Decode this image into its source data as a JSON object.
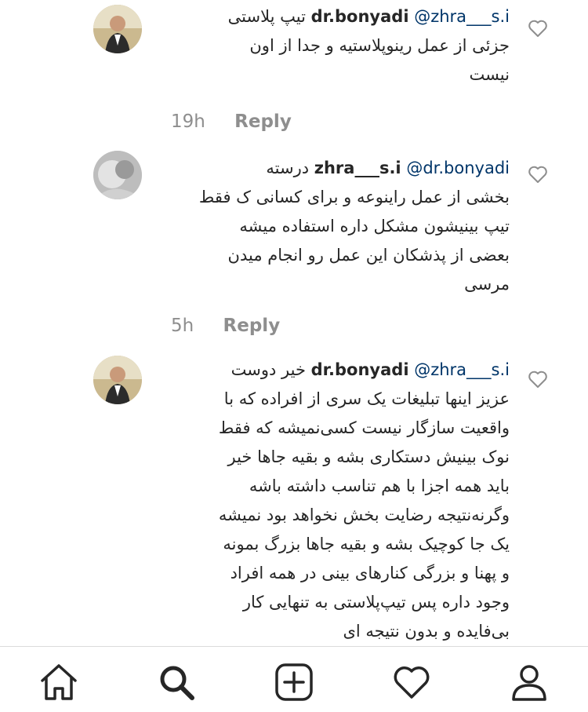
{
  "comments": [
    {
      "username": "dr.bonyadi",
      "mention": "@zhra___s.i",
      "first_line_text": "تیپ پلاستی",
      "lines": [
        "جزئی از عمل رینوپلاستیه و جدا از اون",
        "نیست"
      ],
      "time": "19h",
      "reply": "Reply"
    },
    {
      "username": "zhra___s.i",
      "mention": "@dr.bonyadi",
      "first_line_text": "درسته",
      "lines": [
        "بخشی از عمل راینوعه و برای کسانی ک فقط",
        "تیپ بینیشون مشکل داره استفاده میشه",
        "بعضی از پذشکان این عمل رو انجام میدن",
        "مرسی"
      ],
      "time": "5h",
      "reply": "Reply"
    },
    {
      "username": "dr.bonyadi",
      "mention": "@zhra___s.i",
      "first_line_text": "خیر دوست",
      "lines": [
        "عزیز اینها تبلیغات یک سری از افراده که با",
        "واقعیت سازگار نیست کسی‌نمیشه که فقط",
        "نوک بینیش دستکاری بشه و بقیه جاها خیر",
        "باید همه اجزا با هم تناسب داشته باشه",
        "وگرنه‌نتیجه رضایت بخش نخواهد بود نمیشه",
        "یک جا کوچیک بشه و بقیه جاها بزرگ بمونه",
        "و پهنا و بزرگی کنارهای بینی در همه افراد",
        "وجود داره پس تیپ‌پلاستی به تنهایی کار",
        "بی‌فایده و بدون نتیجه ای"
      ]
    }
  ],
  "nav": {
    "icons": [
      "home-icon",
      "search-icon",
      "new-post-icon",
      "activity-heart-icon",
      "profile-icon"
    ]
  },
  "colors": {
    "mention": "#003569",
    "meta": "#8e8e8e",
    "divider": "#dbdbdb",
    "icon": "#262626"
  }
}
